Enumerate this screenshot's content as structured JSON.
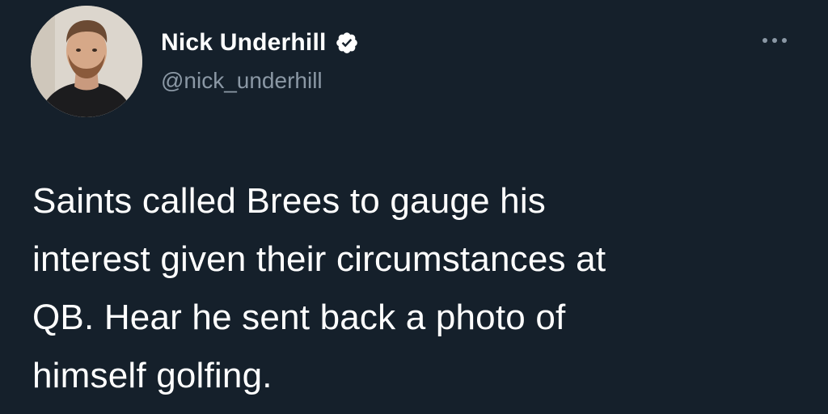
{
  "author": {
    "display_name": "Nick Underhill",
    "handle": "@nick_underhill",
    "verified": true,
    "avatar_icon": "user-photo-icon"
  },
  "menu": {
    "icon": "more-horizontal-icon"
  },
  "tweet": {
    "text": "Saints called Brees to gauge his\ninterest given their circumstances at\nQB. Hear he sent back a photo of\nhimself golfing."
  },
  "colors": {
    "background": "#15202b",
    "text_primary": "#ffffff",
    "text_secondary": "#8b98a5",
    "verified_badge": "#ffffff"
  }
}
